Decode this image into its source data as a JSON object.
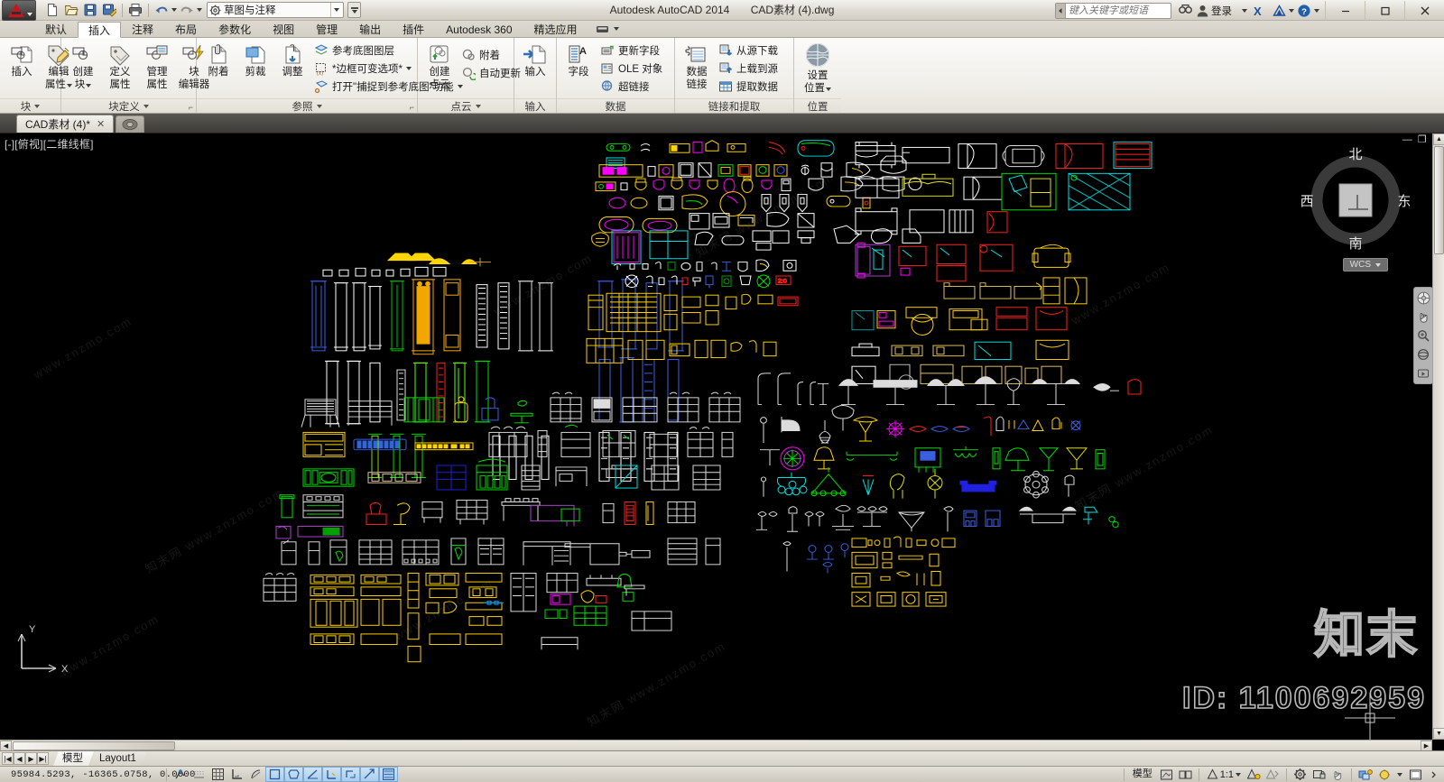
{
  "titlebar": {
    "app_menu": "A",
    "quick_access": [
      {
        "name": "new-file-icon",
        "label": "新建"
      },
      {
        "name": "open-file-icon",
        "label": "打开"
      },
      {
        "name": "save-icon",
        "label": "保存"
      },
      {
        "name": "save-as-icon",
        "label": "另存为"
      },
      {
        "name": "plot-icon",
        "label": "打印"
      },
      {
        "name": "undo-icon",
        "label": "放弃"
      },
      {
        "name": "redo-icon",
        "label": "重做"
      }
    ],
    "workspace": "草图与注释",
    "product_name": "Autodesk AutoCAD 2014",
    "document_name": "CAD素材 (4).dwg",
    "search_placeholder": "键入关键字或短语",
    "sign_in": "登录",
    "window_buttons": {
      "minimize": "—",
      "maximize": "❐",
      "close": "✕"
    }
  },
  "tabs": [
    {
      "label": "默认",
      "active": false
    },
    {
      "label": "插入",
      "active": true
    },
    {
      "label": "注释",
      "active": false
    },
    {
      "label": "布局",
      "active": false
    },
    {
      "label": "参数化",
      "active": false
    },
    {
      "label": "视图",
      "active": false
    },
    {
      "label": "管理",
      "active": false
    },
    {
      "label": "输出",
      "active": false
    },
    {
      "label": "插件",
      "active": false
    },
    {
      "label": "Autodesk 360",
      "active": false
    },
    {
      "label": "精选应用",
      "active": false
    }
  ],
  "ribbon": {
    "panels": [
      {
        "title": "块",
        "big_buttons": [
          {
            "name": "insert-block-button",
            "l1": "插入",
            "l2": "",
            "caret": false,
            "icon": "insert-block-icon"
          },
          {
            "name": "edit-attribute-button",
            "l1": "编辑",
            "l2": "属性",
            "caret": true,
            "icon": "edit-attribute-icon"
          }
        ],
        "small_buttons": []
      },
      {
        "title": "块定义",
        "big_buttons": [
          {
            "name": "create-block-button",
            "l1": "创建",
            "l2": "块",
            "caret": true,
            "icon": "create-block-icon"
          },
          {
            "name": "define-attribute-button",
            "l1": "定义",
            "l2": "属性",
            "caret": false,
            "icon": "define-attribute-icon"
          },
          {
            "name": "manage-attribute-button",
            "l1": "管理",
            "l2": "属性",
            "caret": false,
            "icon": "manage-attribute-icon"
          },
          {
            "name": "block-editor-button",
            "l1": "块",
            "l2": "编辑器",
            "caret": false,
            "icon": "block-editor-icon"
          }
        ],
        "small_buttons": []
      },
      {
        "title": "参照",
        "big_buttons": [
          {
            "name": "attach-button",
            "l1": "附着",
            "l2": "",
            "caret": false,
            "icon": "attach-icon"
          },
          {
            "name": "clip-button",
            "l1": "剪裁",
            "l2": "",
            "caret": false,
            "icon": "clip-icon"
          },
          {
            "name": "adjust-button",
            "l1": "调整",
            "l2": "",
            "caret": false,
            "icon": "adjust-icon"
          }
        ],
        "small_buttons": [
          {
            "name": "underlay-layers-button",
            "label": "参考底图图层",
            "icon": "underlay-layers-icon",
            "caret": false
          },
          {
            "name": "frame-variable-button",
            "label": "*边框可变选项*",
            "icon": "frame-icon",
            "caret": true
          },
          {
            "name": "snap-to-underlay-button",
            "label": "打开\"捕捉到参考底图\"功能",
            "icon": "snap-underlay-icon",
            "caret": true
          }
        ]
      },
      {
        "title": "点云",
        "big_buttons": [
          {
            "name": "create-pointcloud-button",
            "l1": "创建",
            "l2": "点云",
            "caret": false,
            "icon": "create-pointcloud-icon"
          }
        ],
        "small_buttons": [
          {
            "name": "pointcloud-attach-button",
            "label": "附着",
            "icon": "pointcloud-attach-icon",
            "caret": false
          },
          {
            "name": "pointcloud-autoupdate-button",
            "label": "自动更新",
            "icon": "pointcloud-update-icon",
            "caret": false
          }
        ]
      },
      {
        "title": "输入",
        "big_buttons": [
          {
            "name": "import-button",
            "l1": "输入",
            "l2": "",
            "caret": false,
            "icon": "import-icon"
          }
        ],
        "small_buttons": []
      },
      {
        "title": "数据",
        "big_buttons": [
          {
            "name": "field-button",
            "l1": "字段",
            "l2": "",
            "caret": false,
            "icon": "field-icon"
          }
        ],
        "small_buttons": [
          {
            "name": "update-fields-button",
            "label": "更新字段",
            "icon": "update-fields-icon",
            "caret": false
          },
          {
            "name": "ole-object-button",
            "label": "OLE 对象",
            "icon": "ole-object-icon",
            "caret": false
          },
          {
            "name": "hyperlink-button",
            "label": "超链接",
            "icon": "hyperlink-icon",
            "caret": false
          }
        ]
      },
      {
        "title": "链接和提取",
        "big_buttons": [
          {
            "name": "data-link-button",
            "l1": "数据",
            "l2": "链接",
            "caret": false,
            "icon": "data-link-icon"
          }
        ],
        "small_buttons": [
          {
            "name": "download-from-source-button",
            "label": "从源下载",
            "icon": "download-source-icon",
            "caret": false
          },
          {
            "name": "upload-to-source-button",
            "label": "上载到源",
            "icon": "upload-source-icon",
            "caret": false
          },
          {
            "name": "extract-data-button",
            "label": "提取数据",
            "icon": "extract-data-icon",
            "caret": false
          }
        ]
      },
      {
        "title": "位置",
        "big_buttons": [
          {
            "name": "set-location-button",
            "l1": "设置",
            "l2": "位置",
            "caret": true,
            "icon": "set-location-icon"
          }
        ],
        "small_buttons": []
      }
    ]
  },
  "file_tab": {
    "label": "CAD素材 (4)*",
    "close": "✕",
    "new_tab_tooltip": "新建"
  },
  "viewport": {
    "label": "[-][俯视][二维线框]",
    "minimize": "—",
    "maximize": "❐",
    "close": "✕",
    "background_color": "#000000",
    "viewcube": {
      "north": "北",
      "south": "南",
      "east": "东",
      "west": "西",
      "top": "上"
    },
    "ucs_label": "WCS",
    "axis_y": "Y",
    "axis_x": "X",
    "watermark_brand": "知末",
    "watermark_id": "ID: 1100692959",
    "watermark_tiles": [
      "www.znzmo.com",
      "知末网 www.znzmo.com",
      "www.znzmo.com",
      "知末网"
    ]
  },
  "model_tabs": {
    "nav": [
      "|◀",
      "◀",
      "▶",
      "▶|"
    ],
    "items": [
      {
        "label": "模型",
        "active": true
      },
      {
        "label": "Layout1",
        "active": false
      }
    ]
  },
  "statusbar": {
    "coordinates": "95984.5293,  -16365.0758,  0.0000",
    "left_toggles": [
      {
        "name": "infer-constraints-toggle",
        "icon": "infer-icon",
        "on": false
      },
      {
        "name": "snap-mode-toggle",
        "icon": "snap-icon",
        "on": false
      },
      {
        "name": "grid-display-toggle",
        "icon": "grid-icon",
        "on": false
      },
      {
        "name": "ortho-mode-toggle",
        "icon": "ortho-icon",
        "on": false
      },
      {
        "name": "polar-tracking-toggle",
        "icon": "polar-icon",
        "on": false
      },
      {
        "name": "object-snap-toggle",
        "icon": "osnap-icon",
        "on": true
      },
      {
        "name": "3d-object-snap-toggle",
        "icon": "osnap3d-icon",
        "on": true
      },
      {
        "name": "object-snap-tracking-toggle",
        "icon": "otrack-icon",
        "on": true
      },
      {
        "name": "allow-ucs-toggle",
        "icon": "ucsicon-icon",
        "on": true
      },
      {
        "name": "dynamic-ucs-toggle",
        "icon": "dynucs-icon",
        "on": true
      },
      {
        "name": "dynamic-input-toggle",
        "icon": "dyninput-icon",
        "on": true
      },
      {
        "name": "lineweight-toggle",
        "icon": "lineweight-icon",
        "on": true
      }
    ],
    "space_label": "模型",
    "annotation_scale": "1:1",
    "right_toggles": [
      {
        "name": "quick-view-layouts-button",
        "icon": "quickview-layouts-icon"
      },
      {
        "name": "quick-view-drawings-button",
        "icon": "quickview-drawings-icon"
      },
      {
        "name": "annotation-visibility-button",
        "icon": "annotation-visibility-icon"
      },
      {
        "name": "auto-scale-button",
        "icon": "auto-scale-icon"
      },
      {
        "name": "workspace-switch-button",
        "icon": "workspace-gear-icon"
      },
      {
        "name": "toolbar-lock-button",
        "icon": "lock-icon"
      },
      {
        "name": "hardware-accel-button",
        "icon": "hardware-icon"
      },
      {
        "name": "isolate-objects-button",
        "icon": "isolate-icon"
      },
      {
        "name": "status-bar-menu-button",
        "icon": "status-menu-icon"
      },
      {
        "name": "clean-screen-button",
        "icon": "clean-screen-icon"
      }
    ]
  },
  "colors": {
    "canvas": "#000000",
    "ribbon_bg": "#f0eee8",
    "accent_blue": "#2f6fb5",
    "cad_white": "#ffffff",
    "cad_yellow": "#ffd400",
    "cad_green": "#00ff00",
    "cad_cyan": "#00ffff",
    "cad_blue": "#0000ff",
    "cad_magenta": "#ff00ff",
    "cad_red": "#ff0000"
  }
}
